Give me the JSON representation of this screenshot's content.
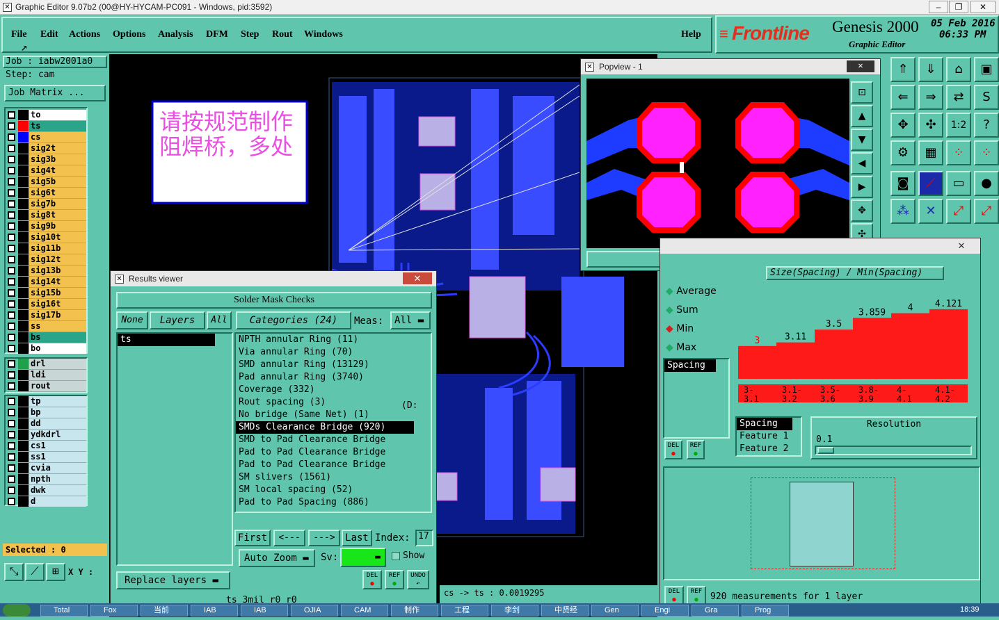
{
  "window": {
    "title": "Graphic Editor 9.07b2 (00@HY-HYCAM-PC091 - Windows, pid:3592)",
    "min": "–",
    "max": "❐",
    "close": "✕"
  },
  "menu": {
    "items": [
      "File",
      "Edit",
      "Actions",
      "Options",
      "Analysis",
      "DFM",
      "Step",
      "Rout",
      "Windows"
    ],
    "help": "Help"
  },
  "logo": {
    "brand": "Frontline",
    "product": "Genesis 2000",
    "subtitle": "Graphic Editor",
    "date": "05 Feb 2016",
    "time": "06:33 PM"
  },
  "job": {
    "job_label": "Job : iabw2001a0",
    "step_label": "Step: cam",
    "matrix_button": "Job Matrix ..."
  },
  "layers": [
    {
      "name": "to",
      "color": "#ffffff",
      "swatch": "#000000"
    },
    {
      "name": "ts",
      "color": "#2aa58a",
      "swatch": "#ff0000",
      "active": true
    },
    {
      "name": "cs",
      "color": "#f2c14e",
      "swatch": "#0000ff"
    },
    {
      "name": "sig2t",
      "color": "#f2c14e"
    },
    {
      "name": "sig3b",
      "color": "#f2c14e"
    },
    {
      "name": "sig4t",
      "color": "#f2c14e"
    },
    {
      "name": "sig5b",
      "color": "#f2c14e"
    },
    {
      "name": "sig6t",
      "color": "#f2c14e"
    },
    {
      "name": "sig7b",
      "color": "#f2c14e"
    },
    {
      "name": "sig8t",
      "color": "#f2c14e"
    },
    {
      "name": "sig9b",
      "color": "#f2c14e"
    },
    {
      "name": "sig10t",
      "color": "#f2c14e"
    },
    {
      "name": "sig11b",
      "color": "#f2c14e"
    },
    {
      "name": "sig12t",
      "color": "#f2c14e"
    },
    {
      "name": "sig13b",
      "color": "#f2c14e"
    },
    {
      "name": "sig14t",
      "color": "#f2c14e"
    },
    {
      "name": "sig15b",
      "color": "#f2c14e"
    },
    {
      "name": "sig16t",
      "color": "#f2c14e"
    },
    {
      "name": "sig17b",
      "color": "#f2c14e"
    },
    {
      "name": "ss",
      "color": "#f2c14e"
    },
    {
      "name": "bs",
      "color": "#2aa58a"
    },
    {
      "name": "bo",
      "color": "#ffffff"
    }
  ],
  "drill_layers": [
    "drl",
    "ldi",
    "rout"
  ],
  "misc_layers": [
    "tp",
    "bp",
    "dd",
    "ydkdrl",
    "cs1",
    "ss1",
    "cvia",
    "npth",
    "dwk",
    "d"
  ],
  "selected": "Selected : 0",
  "xy_label": "X Y :",
  "note": {
    "line1": "请按规范制作",
    "line2": "阻焊桥，多处"
  },
  "popview": {
    "title": "Popview - 1",
    "close_button": "Close",
    "close_x": "✕"
  },
  "results": {
    "title": "Results viewer",
    "header": "Solder Mask Checks",
    "none_btn": "None",
    "layers_btn": "Layers",
    "all_btn": "All",
    "categories_btn": "Categories (24)",
    "meas_label": "Meas:",
    "meas_value": "All",
    "layer_items": [
      "ts"
    ],
    "categories": [
      "NPTH annular Ring (11)",
      "Via annular Ring (70)",
      "SMD annular Ring (13129)",
      "Pad annular Ring (3740)",
      "Coverage (332)",
      "Rout spacing (3)",
      "No bridge (Same Net) (1)",
      "SMDs Clearance Bridge (920)",
      "SMD to Pad Clearance Bridge",
      "Pad to Pad Clearance Bridge",
      "Pad to Pad Clearance Bridge",
      "SM slivers (1561)",
      "SM local spacing (52)",
      "Pad to Pad Spacing (886)"
    ],
    "rout_suffix": "(D:",
    "selected_index": 7,
    "first": "First",
    "prev": "<---",
    "next": "--->",
    "last": "Last",
    "index_label": "Index:",
    "index_value": "17",
    "auto_zoom": "Auto Zoom",
    "sv_label": "Sv:",
    "show_label": "Show",
    "replace_layers": "Replace layers",
    "del": "DEL",
    "ref": "REF",
    "undo": "UNDO",
    "status": "ts 3mil   r0   r0"
  },
  "canvas_status": "cs -> ts : 0.0019295",
  "histogram": {
    "header": "Size(Spacing) / Min(Spacing)",
    "options": [
      "Average",
      "Sum",
      "Min",
      "Max"
    ],
    "selected_option": "Min",
    "list_item": "Spacing",
    "left_items": [
      "Spacing",
      "Feature 1",
      "Feature 2"
    ],
    "resolution_label": "Resolution",
    "resolution_value": "0.1",
    "del": "DEL",
    "ref": "REF",
    "footer": "920 measurements for 1 layer"
  },
  "chart_data": {
    "type": "bar",
    "categories": [
      "3-3.1",
      "3.1-3.2",
      "3.5-3.6",
      "3.8-3.9",
      "4-4.1",
      "4.1-4.2"
    ],
    "values": [
      3,
      3.11,
      3.5,
      3.859,
      4,
      4.121
    ],
    "value_labels": [
      "3",
      "3.11",
      "3.5",
      "3.859",
      "4",
      "4.121"
    ],
    "value_label_colors": [
      "#ff0000",
      "#000000",
      "#000000",
      "#000000",
      "#000000",
      "#000000"
    ],
    "bar_color": "#ff1a1a",
    "title": "",
    "xlabel": "",
    "ylabel": ""
  },
  "taskbar": [
    "Total",
    "Fox",
    "当前",
    "IAB",
    "IAB",
    "OJIA",
    "CAM",
    "制作",
    "工程",
    "李剑",
    "中贤经",
    "Gen",
    "Engi",
    "Gra",
    "Prog"
  ],
  "clock": "18:39"
}
